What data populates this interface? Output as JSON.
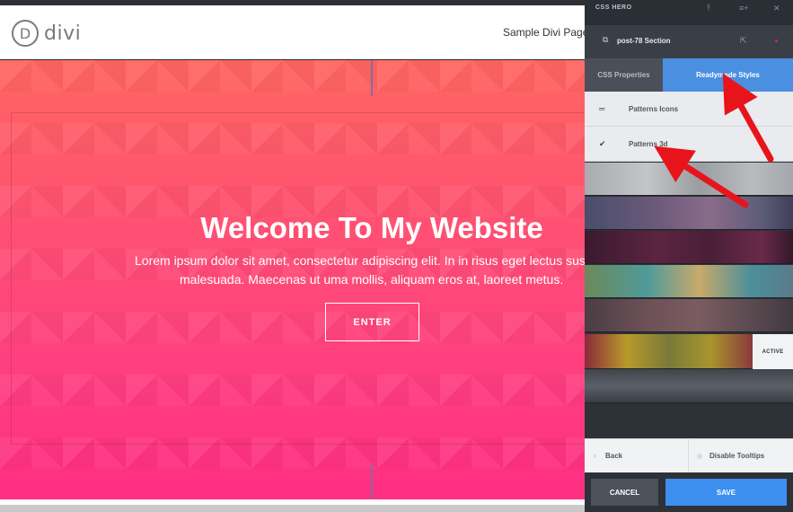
{
  "site": {
    "logo_letter": "D",
    "logo_text": "divi",
    "nav_link": "Sample Divi Page"
  },
  "hero": {
    "title": "Welcome To My Website",
    "body_line1": "Lorem ipsum dolor sit amet, consectetur adipiscing elit. In in risus eget lectus sus",
    "body_line2": "malesuada. Maecenas ut uma mollis, aliquam eros at, laoreet metus.",
    "button_label": "ENTER"
  },
  "panel": {
    "brand": "CSS HERO",
    "section_title": "post-78 Section",
    "tabs": [
      {
        "label": "CSS Properties",
        "active": false
      },
      {
        "label": "Readymade Styles",
        "active": true
      }
    ],
    "list_items": [
      {
        "label": "Patterns Icons",
        "icon": "menu-lines-icon"
      },
      {
        "label": "Patterns 3d",
        "icon": "check-icon"
      }
    ],
    "active_label": "ACTIVE",
    "back_label": "Back",
    "disable_tooltips_label": "Disable Tooltips",
    "cancel_label": "CANCEL",
    "save_label": "SAVE"
  },
  "colors": {
    "accent_blue": "#4a8fe0",
    "save_blue": "#3d8ff0",
    "hero_top": "#ff6660",
    "hero_bottom": "#ff2e82",
    "annotation_red": "#e8141c"
  }
}
